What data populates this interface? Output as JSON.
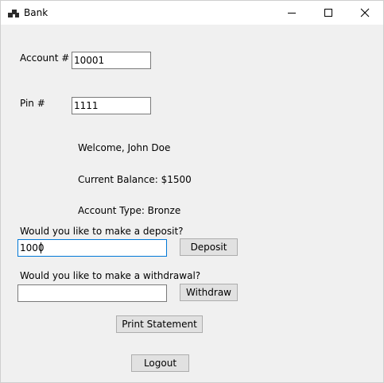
{
  "window": {
    "title": "Bank",
    "icon": "bank-app-icon"
  },
  "account": {
    "label": "Account #",
    "value": "10001"
  },
  "pin": {
    "label": "Pin #",
    "value": "1111"
  },
  "info": {
    "welcome": "Welcome, John Doe",
    "balance": "Current Balance: $1500",
    "account_type": "Account Type: Bronze"
  },
  "deposit": {
    "prompt": "Would you like to make a deposit?",
    "value": "1000",
    "button_label": "Deposit"
  },
  "withdraw": {
    "prompt": "Would you like to make a withdrawal?",
    "value": "",
    "button_label": "Withdraw"
  },
  "actions": {
    "print_label": "Print Statement",
    "logout_label": "Logout"
  },
  "colors": {
    "focus_border": "#0078d7",
    "form_background": "#f0f0f0",
    "button_face": "#e1e1e1"
  }
}
